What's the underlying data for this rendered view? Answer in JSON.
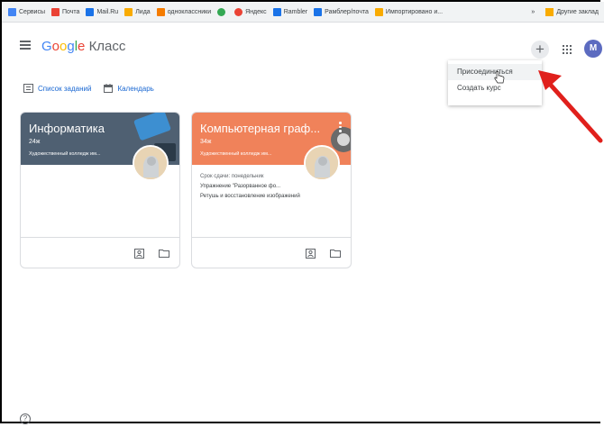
{
  "bookmarks": [
    {
      "label": "Сервисы",
      "icon": "apps-icon",
      "color": "#4285f4"
    },
    {
      "label": "Почта",
      "icon": "mail-icon",
      "color": "#ea4335"
    },
    {
      "label": "Mail.Ru",
      "icon": "mailru-icon",
      "color": "#1a73e8"
    },
    {
      "label": "Лида",
      "icon": "folder-icon",
      "color": "#f9ab00"
    },
    {
      "label": "одноклассники",
      "icon": "odnoklassniki-icon",
      "color": "#f57c00"
    },
    {
      "label": "",
      "icon": "chrome-icon",
      "color": "#34a853"
    },
    {
      "label": "Яндекс",
      "icon": "yandex-icon",
      "color": "#ea4335"
    },
    {
      "label": "Rambler",
      "icon": "rambler-icon",
      "color": "#1a73e8"
    },
    {
      "label": "Рамблер/почта",
      "icon": "rambler-mail-icon",
      "color": "#1a73e8"
    },
    {
      "label": "Импортировано и...",
      "icon": "folder-icon",
      "color": "#f9ab00"
    }
  ],
  "bookmarks_more": "»",
  "other_bookmarks": "Другие заклад",
  "app": {
    "logo_google": "Google",
    "logo_product": "Класс",
    "avatar_letter": "M",
    "add_symbol": "+"
  },
  "menu": {
    "join": "Присоединиться",
    "create": "Создать курс"
  },
  "toolbar": {
    "todo": "Список заданий",
    "calendar": "Календарь"
  },
  "colors": {
    "card1": "#4f6072",
    "card2": "#f0825a",
    "accent": "#1967d2",
    "arrow": "#e0201c"
  },
  "courses": [
    {
      "title": "Информатика",
      "section": "24ж",
      "teacher": "Художественный колледж им...",
      "due": "",
      "assignments": []
    },
    {
      "title": "Компьютерная граф...",
      "section": "34ж",
      "teacher": "Художественный колледж им...",
      "due": "Срок сдачи: понедельник",
      "assignments": [
        "Упражнение \"Разорванное фо...",
        "Ретушь и восстановление изображений"
      ]
    }
  ],
  "help_symbol": "?"
}
